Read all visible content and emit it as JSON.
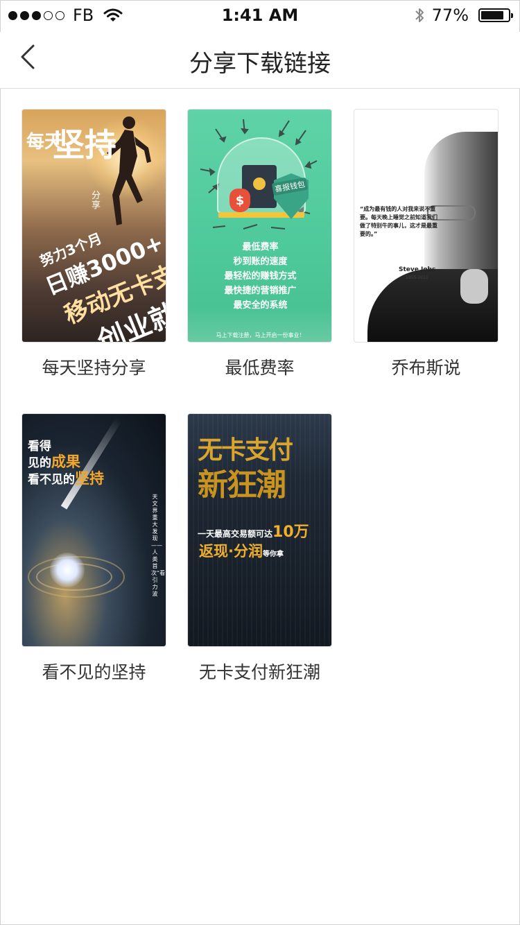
{
  "status_bar": {
    "carrier": "FB",
    "time": "1:41 AM",
    "battery_percent": "77%",
    "battery_level": 0.77,
    "icons": [
      "signal-dots-icon",
      "wifi-icon",
      "bluetooth-icon",
      "battery-icon"
    ]
  },
  "nav": {
    "title": "分享下载链接",
    "back_icon": "chevron-left-icon"
  },
  "items": [
    {
      "caption": "每天坚持分享",
      "poster": {
        "line1": "每天",
        "line2": "坚持",
        "tag": "分享",
        "slant1": "努力3个月",
        "slant2": "日赚3000+",
        "slant3": "移动无卡支付",
        "slant4": "创业就是这么简单!"
      }
    },
    {
      "caption": "最低费率",
      "poster": {
        "shield_label": "喜报钱包",
        "lines": [
          "最低费率",
          "秒到账的速度",
          "最轻松的赚钱方式",
          "最快捷的营销推广",
          "最安全的系统"
        ],
        "footer": "马上下载注册，马上开启一份事业！"
      }
    },
    {
      "caption": "乔布斯说",
      "poster": {
        "quote": "“成为最有钱的人对我来说不重要。每天晚上睡觉之前知道我们做了特别牛的事儿，这才是最重要的。”",
        "author": "Steve Jobs",
        "years": "1955-2011"
      }
    },
    {
      "caption": "看不见的坚持",
      "poster": {
        "line1": "看得",
        "line2a": "见的",
        "line2b": "成果",
        "line3a": "看不见的",
        "line3b": "坚持",
        "vertical": "天文界重大发现——人类首次“看”到引力波"
      }
    },
    {
      "caption": "无卡支付新狂潮",
      "poster": {
        "gold1": "无卡支付",
        "gold2": "新狂潮",
        "line1a": "一天最高交易额可达",
        "line1b": "10万",
        "line2a": "返现·分润",
        "line2b": "等你拿"
      }
    }
  ],
  "colors": {
    "accent_gold": "#f0b02c",
    "poster2_green": "#4ec99a"
  }
}
